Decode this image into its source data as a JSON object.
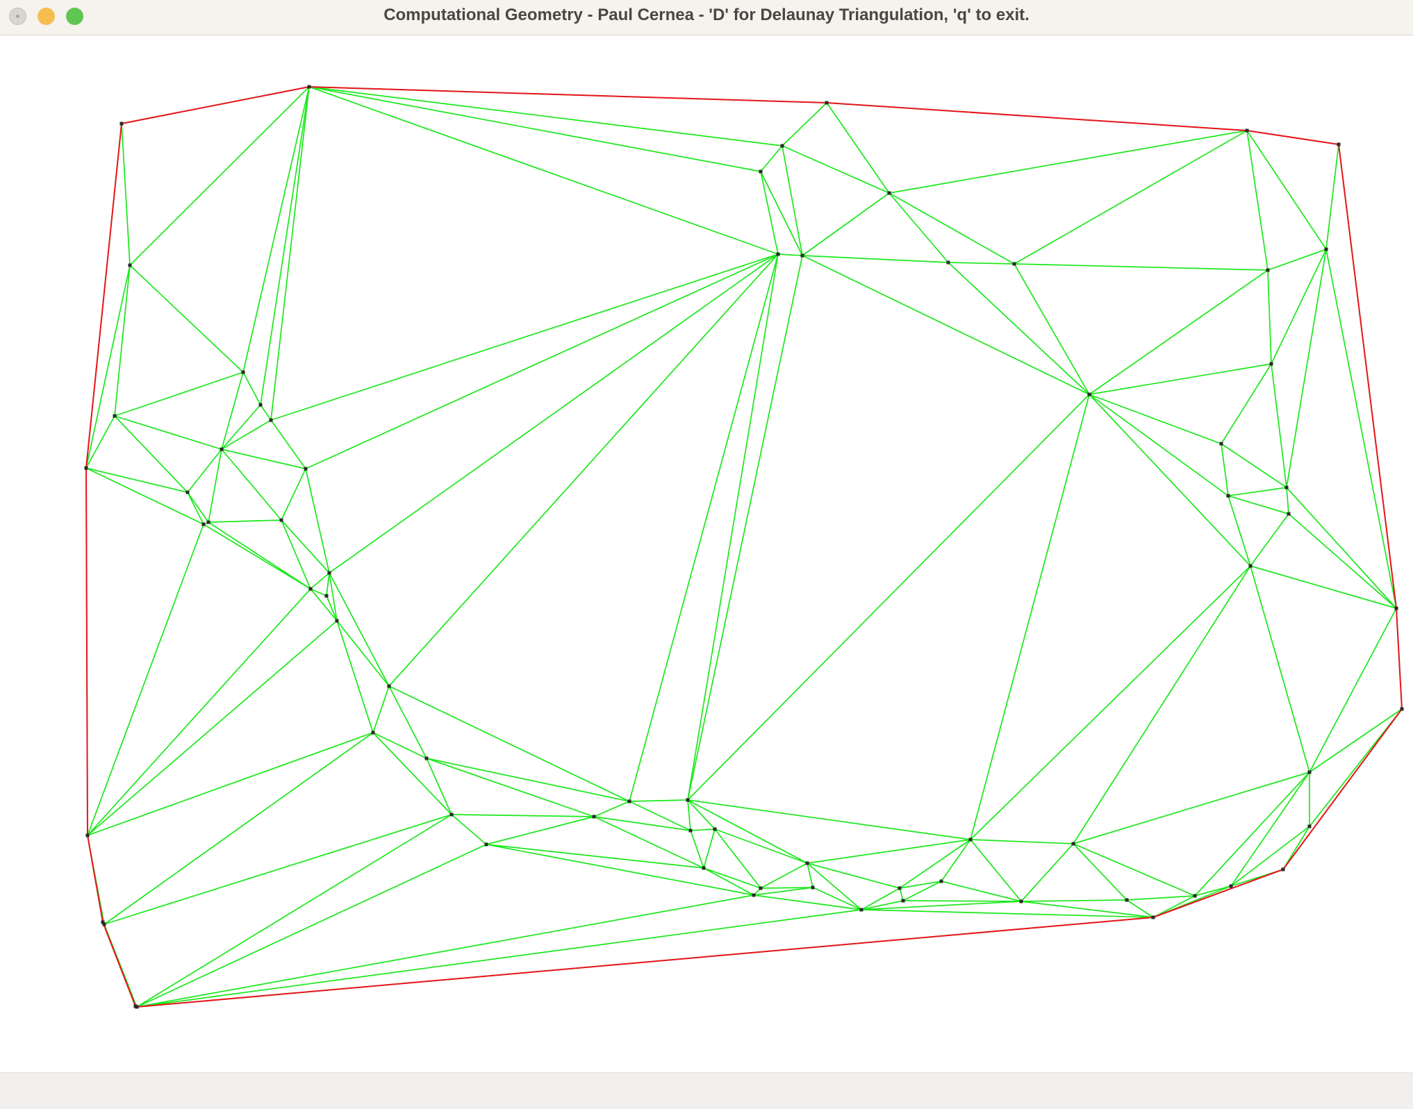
{
  "window": {
    "title": "Computational Geometry - Paul Cernea - 'D' for Delaunay Triangulation, 'q' to exit."
  },
  "colors": {
    "hull_edge": "#e8141c",
    "triangulation_edge": "#1ae81a",
    "vertex": "#2a2a2a",
    "background": "#ffffff"
  },
  "chart_data": {
    "type": "scatter",
    "x": [
      175,
      445,
      1190,
      1795,
      1927,
      1909,
      1825,
      1830,
      1126,
      1095,
      1120,
      1155,
      1280,
      1365,
      1460,
      1568,
      1758,
      1768,
      1852,
      1855,
      1800,
      2010,
      2018,
      1885,
      1885,
      1847,
      1772,
      1720,
      1660,
      1622,
      1545,
      1470,
      1397,
      1355,
      1295,
      1300,
      1240,
      1170,
      1162,
      1095,
      1085,
      1013,
      994,
      990,
      855,
      1029,
      906,
      700,
      650,
      614,
      560,
      537,
      485,
      474,
      470,
      447,
      440,
      405,
      390,
      375,
      350,
      319,
      300,
      293,
      270,
      187,
      165,
      124,
      126,
      148,
      150,
      197,
      195
    ],
    "y": [
      178,
      125,
      148,
      188,
      208,
      359,
      389,
      524,
      210,
      247,
      366,
      368,
      278,
      378,
      380,
      568,
      639,
      714,
      702,
      740,
      815,
      876,
      1021,
      1112,
      1190,
      1252,
      1276,
      1290,
      1321,
      1296,
      1215,
      1298,
      1209,
      1269,
      1279,
      1297,
      1310,
      1278,
      1243,
      1279,
      1289,
      1250,
      1196,
      1152,
      1176,
      1194,
      1154,
      1216,
      1173,
      1092,
      988,
      1055,
      894,
      825,
      858,
      848,
      675,
      749,
      605,
      583,
      536,
      647,
      752,
      755,
      709,
      382,
      599,
      674,
      1203,
      1328,
      1331,
      1450,
      1449
    ]
  }
}
